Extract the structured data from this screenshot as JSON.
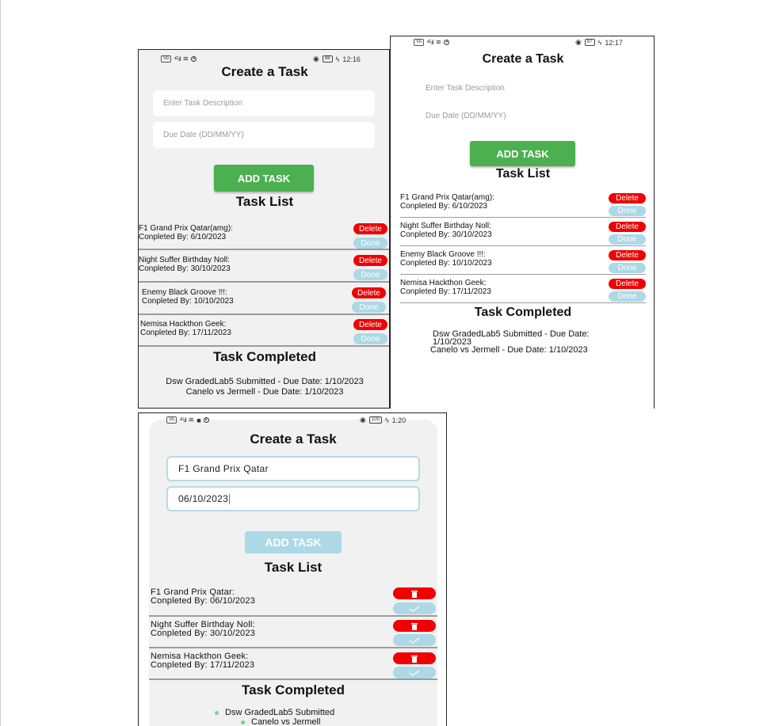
{
  "screens": [
    {
      "status": {
        "left_icons": "VoLTE 4G",
        "battery": "86",
        "time": "12:16"
      },
      "title": "Create a Task",
      "description_placeholder": "Enter Task Description",
      "date_placeholder": "Due Date (DD/MM/YY)",
      "add_button": "ADD TASK",
      "task_list_title": "Task List",
      "tasks": [
        {
          "name": "F1 Grand Prix Qatar(amg):",
          "date": "Conpleted By: 6/10/2023",
          "delete": "Delete",
          "done": "Done"
        },
        {
          "name": "Night Suffer Birthday Noll:",
          "date": "Conpleted By: 30/10/2023",
          "delete": "Delete",
          "done": "Done"
        },
        {
          "name": "Enemy Black Groove !!!:",
          "date": "Conpleted By: 10/10/2023",
          "delete": "Delete",
          "done": "Done"
        },
        {
          "name": "Nemisa Hackthon Geek:",
          "date": "Conpleted By: 17/11/2023",
          "delete": "Delete",
          "done": "Done"
        }
      ],
      "completed_title": "Task Completed",
      "completed": [
        "Dsw GradedLab5 Submitted - Due Date: 1/10/2023",
        "Canelo vs Jermell - Due Date: 1/10/2023"
      ]
    },
    {
      "status": {
        "left_icons": "VoLTE 4G",
        "battery": "87",
        "time": "12:17"
      },
      "title": "Create a Task",
      "description_placeholder": "Enter Task Description",
      "date_placeholder": "Due Date (DD/MM/YY)",
      "add_button": "ADD TASK",
      "task_list_title": "Task List",
      "tasks": [
        {
          "name": "F1 Grand Prix Qatar(amg):",
          "date": "Conpleted By: 6/10/2023",
          "delete": "Delete",
          "done": "Done"
        },
        {
          "name": "Night Suffer Birthday Noll:",
          "date": "Conpleted By: 30/10/2023",
          "delete": "Delete",
          "done": "Done"
        },
        {
          "name": "Enemy Black Groove !!!:",
          "date": "Conpleted By: 10/10/2023",
          "delete": "Delete",
          "done": "Done"
        },
        {
          "name": "Nemisa Hackthon Geek:",
          "date": "Conpleted By: 17/11/2023",
          "delete": "Delete",
          "done": "Done"
        }
      ],
      "completed_title": "Task Completed",
      "completed": [
        "Dsw GradedLab5 Submitted - Due Date:",
        "1/10/2023",
        "Canelo vs Jermell - Due Date: 1/10/2023"
      ]
    },
    {
      "status": {
        "left_icons": "VoLTE 4G",
        "battery": "100",
        "time": "1:20"
      },
      "title": "Create a Task",
      "description_value": "F1 Grand Prix Qatar",
      "date_value": "06/10/2023",
      "add_button": "ADD TASK",
      "task_list_title": "Task List",
      "tasks": [
        {
          "name": "F1 Grand Prix Qatar:",
          "date": "Conpleted By: 06/10/2023",
          "delete_icon": "trash-icon",
          "done_icon": "check-icon"
        },
        {
          "name": "Night Suffer Birthday Noll:",
          "date": "Conpleted By: 30/10/2023",
          "delete_icon": "trash-icon",
          "done_icon": "check-icon"
        },
        {
          "name": "Nemisa Hackthon Geek:",
          "date": "Conpleted By: 17/11/2023",
          "delete_icon": "trash-icon",
          "done_icon": "check-icon"
        }
      ],
      "completed_title": "Task Completed",
      "completed": [
        "Dsw GradedLab5 Submitted",
        "Canelo vs Jermell"
      ]
    }
  ],
  "colors": {
    "green": "#4caf50",
    "red": "#f00000",
    "light_blue": "#add8e6",
    "screen_bg": "#f1f1f1"
  }
}
